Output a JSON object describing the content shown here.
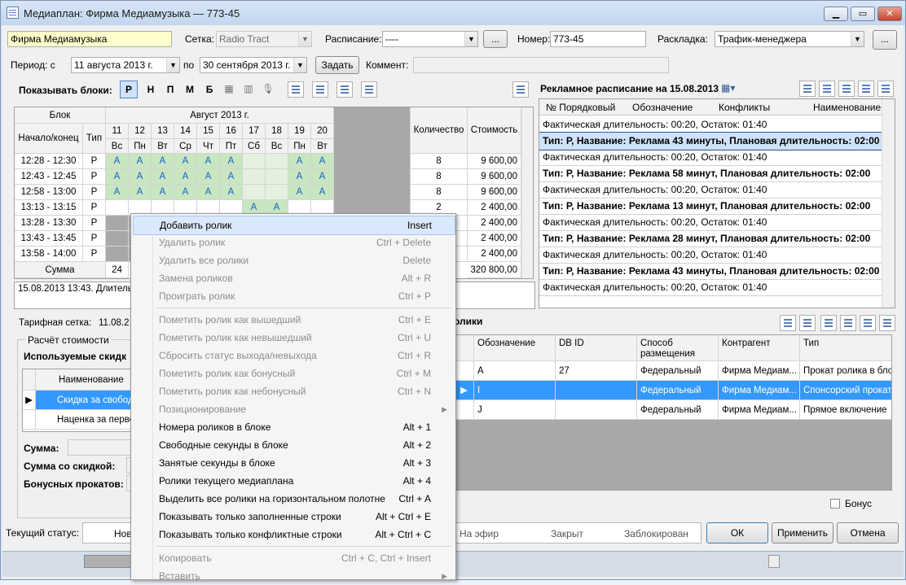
{
  "window": {
    "title": "Медиаплан: Фирма Медиамузыка — 773-45"
  },
  "form": {
    "name_value": "Фирма Медиамузыка",
    "setka_label": "Сетка:",
    "setka_value": "Radio Tract",
    "raspisanie_label": "Расписание:",
    "raspisanie_value": "----",
    "browse": "...",
    "nomer_label": "Номер:",
    "nomer_value": "773-45",
    "raskladka_label": "Раскладка:",
    "raskladka_value": "Трафик-менеджера",
    "period_label": "Период: с",
    "date_from": "11  августа  2013 г.",
    "po_label": "по",
    "date_to": "30 сентября 2013 г.",
    "zadat_button": "Задать",
    "comment_label": "Коммент:"
  },
  "blocks_toolbar": {
    "label": "Показывать блоки:",
    "letters": [
      "Р",
      "Н",
      "П",
      "М",
      "Б"
    ]
  },
  "block_grid": {
    "group_block": "Блок",
    "month": "Август 2013 г.",
    "col_time": "Начало/конец",
    "col_type": "Тип",
    "days": [
      "11",
      "12",
      "13",
      "14",
      "15",
      "16",
      "17",
      "18",
      "19",
      "20"
    ],
    "weekdays": [
      "Вс",
      "Пн",
      "Вт",
      "Ср",
      "Чт",
      "Пт",
      "Сб",
      "Вс",
      "Пн",
      "Вт"
    ],
    "col_qty": "Количество",
    "col_cost": "Стоимость",
    "rows": [
      {
        "time": "12:28 - 12:30",
        "type": "Р",
        "marks": [
          "A",
          "A",
          "A",
          "A",
          "A",
          "A",
          "",
          "",
          "A",
          "A"
        ],
        "qty": "8",
        "cost": "9 600,00"
      },
      {
        "time": "12:43 - 12:45",
        "type": "Р",
        "marks": [
          "A",
          "A",
          "A",
          "A",
          "A",
          "A",
          "",
          "",
          "A",
          "A"
        ],
        "qty": "8",
        "cost": "9 600,00"
      },
      {
        "time": "12:58 - 13:00",
        "type": "Р",
        "marks": [
          "A",
          "A",
          "A",
          "A",
          "A",
          "A",
          "",
          "",
          "A",
          "A"
        ],
        "qty": "8",
        "cost": "9 600,00"
      },
      {
        "time": "13:13 - 13:15",
        "type": "Р",
        "marks": [
          "",
          "",
          "",
          "",
          "",
          "",
          "A",
          "A",
          "",
          ""
        ],
        "qty": "2",
        "cost": "2 400,00"
      },
      {
        "time": "13:28 - 13:30",
        "type": "Р",
        "marks": [],
        "qty": "",
        "cost": "2 400,00"
      },
      {
        "time": "13:43 - 13:45",
        "type": "Р",
        "marks": [],
        "qty": "",
        "cost": "2 400,00"
      },
      {
        "time": "13:58 - 14:00",
        "type": "Р",
        "marks": [],
        "qty": "",
        "cost": "2 400,00"
      }
    ],
    "sum_label": "Сумма",
    "sum_count": "24",
    "sum_cost": "320 800,00"
  },
  "info_text": "15.08.2013 13:43. Длительн",
  "tariff": {
    "label": "Тарифная сетка:",
    "value": "11.08.2"
  },
  "calc": {
    "group_label": "Расчёт стоимости",
    "used_discounts": "Используемые скидк",
    "col_name": "Наименование",
    "rows": [
      "Скидка за свобод",
      "Наценка за перво"
    ],
    "summa_label": "Сумма:",
    "summa_disc_label": "Сумма со скидкой:",
    "bonus_label": "Бонусных прокатов:"
  },
  "schedule": {
    "title": "Рекламное расписание на 15.08.2013",
    "cols": [
      "№ Порядковый",
      "Обозначение",
      "Конфликты",
      "Наименование"
    ],
    "rows": [
      {
        "text": "Фактическая длительность: 00:20, Остаток: 01:40",
        "bold": false,
        "selected": false
      },
      {
        "text": "Тип: Р, Название: Реклама 43 минуты, Плановая длительность: 02:00",
        "bold": true,
        "selected": true
      },
      {
        "text": "Фактическая длительность: 00:20, Остаток: 01:40",
        "bold": false,
        "selected": false
      },
      {
        "text": "Тип: Р, Название: Реклама 58 минут, Плановая длительность: 02:00",
        "bold": true,
        "selected": false
      },
      {
        "text": "Фактическая длительность: 00:20, Остаток: 01:40",
        "bold": false,
        "selected": false
      },
      {
        "text": "Тип: Р, Название: Реклама 13 минут, Плановая длительность: 02:00",
        "bold": true,
        "selected": false
      },
      {
        "text": "Фактическая длительность: 00:20, Остаток: 01:40",
        "bold": false,
        "selected": false
      },
      {
        "text": "Тип: Р, Название: Реклама 28 минут, Плановая длительность: 02:00",
        "bold": true,
        "selected": false
      },
      {
        "text": "Фактическая длительность: 00:20, Остаток: 01:40",
        "bold": false,
        "selected": false
      },
      {
        "text": "Тип: Р, Название: Реклама 43 минуты, Плановая длительность: 02:00",
        "bold": true,
        "selected": false
      },
      {
        "text": "Фактическая длительность: 00:20, Остаток: 01:40",
        "bold": false,
        "selected": false
      }
    ]
  },
  "rolls": {
    "title_fragment": "олики",
    "cols": [
      "Обозначение",
      "DB ID",
      "Способ размещения",
      "Контрагент",
      "Тип"
    ],
    "rows": [
      [
        "A",
        "27",
        "Федеральный",
        "Фирма Медиам...",
        "Прокат ролика в бло"
      ],
      [
        "I",
        "",
        "Федеральный",
        "Фирма Медиам...",
        "Спонсорский прокат"
      ],
      [
        "J",
        "",
        "Федеральный",
        "Фирма Медиам...",
        "Прямое включение"
      ]
    ]
  },
  "bonus_checkbox": "Бонус",
  "status": {
    "label": "Текущий статус:",
    "items": [
      "Нов",
      "На эфир",
      "Закрыт",
      "Заблокирован"
    ],
    "ok": "ОК",
    "apply": "Применить",
    "cancel": "Отмена"
  },
  "context_menu": [
    {
      "label": "Добавить ролик",
      "shortcut": "Insert",
      "enabled": true,
      "highlight": true
    },
    {
      "label": "Удалить ролик",
      "shortcut": "Ctrl + Delete",
      "enabled": false
    },
    {
      "label": "Удалить все ролики",
      "shortcut": "Delete",
      "enabled": false
    },
    {
      "label": "Замена роликов",
      "shortcut": "Alt + R",
      "enabled": false
    },
    {
      "label": "Проиграть ролик",
      "shortcut": "Ctrl + P",
      "enabled": false
    },
    {
      "separator": true
    },
    {
      "label": "Пометить ролик как вышедший",
      "shortcut": "Ctrl + E",
      "enabled": false
    },
    {
      "label": "Пометить ролик как невышедший",
      "shortcut": "Ctrl + U",
      "enabled": false
    },
    {
      "label": "Сбросить статус выхода/невыхода",
      "shortcut": "Ctrl + R",
      "enabled": false
    },
    {
      "label": "Пометить ролик как бонусный",
      "shortcut": "Ctrl + M",
      "enabled": false
    },
    {
      "label": "Пометить ролик как небонусный",
      "shortcut": "Ctrl + N",
      "enabled": false
    },
    {
      "label": "Позиционирование",
      "shortcut": "",
      "enabled": false,
      "submenu": true
    },
    {
      "label": "Номера роликов в блоке",
      "shortcut": "Alt + 1",
      "enabled": true
    },
    {
      "label": "Свободные секунды в блоке",
      "shortcut": "Alt + 2",
      "enabled": true
    },
    {
      "label": "Занятые секунды в блоке",
      "shortcut": "Alt + 3",
      "enabled": true
    },
    {
      "label": "Ролики текущего медиаплана",
      "shortcut": "Alt + 4",
      "enabled": true
    },
    {
      "label": "Выделить все ролики на горизонтальном полотне",
      "shortcut": "Ctrl + A",
      "enabled": true
    },
    {
      "label": "Показывать только заполненные строки",
      "shortcut": "Alt + Ctrl + E",
      "enabled": true
    },
    {
      "label": "Показывать только конфликтные строки",
      "shortcut": "Alt + Ctrl + C",
      "enabled": true
    },
    {
      "separator": true
    },
    {
      "label": "Копировать",
      "shortcut": "Ctrl + C, Ctrl + Insert",
      "enabled": false
    },
    {
      "label": "Вставить",
      "shortcut": "",
      "enabled": false,
      "submenu": true
    }
  ]
}
